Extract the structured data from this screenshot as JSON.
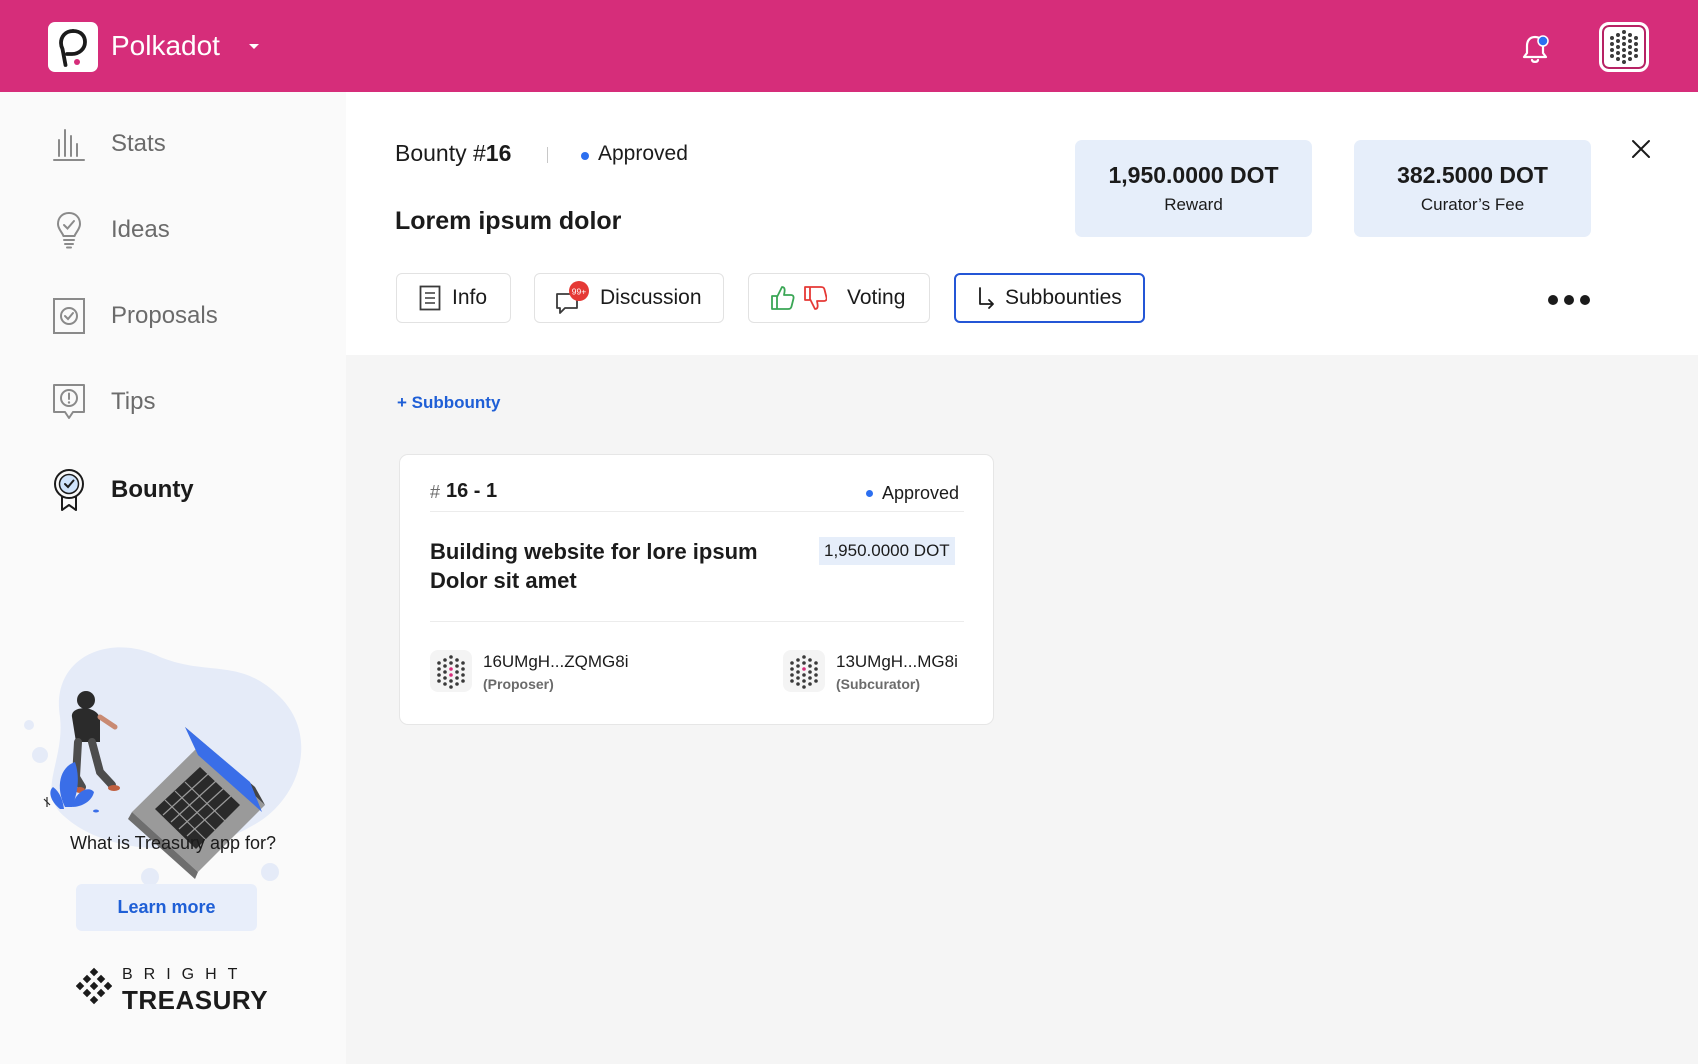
{
  "header": {
    "network_name": "Polkadot",
    "logo_icon": "polkadot-logo",
    "notification_icon": "bell-icon",
    "avatar_icon": "identicon-avatar",
    "brand_color": "#d62d7a"
  },
  "sidebar": {
    "items": [
      {
        "label": "Stats",
        "icon": "stats-icon",
        "active": false
      },
      {
        "label": "Ideas",
        "icon": "lightbulb-icon",
        "active": false
      },
      {
        "label": "Proposals",
        "icon": "proposal-check-icon",
        "active": false
      },
      {
        "label": "Tips",
        "icon": "tip-alert-icon",
        "active": false
      },
      {
        "label": "Bounty",
        "icon": "bounty-badge-icon",
        "active": true
      }
    ],
    "promo_text": "What is Treasury app for?",
    "learn_more_label": "Learn more",
    "brand_top": "BRIGHT",
    "brand_bottom": "TREASURY"
  },
  "bounty": {
    "label": "Bounty #",
    "number": "16",
    "status": "Approved",
    "title": "Lorem ipsum dolor",
    "reward_value": "1,950.0000 DOT",
    "reward_label": "Reward",
    "fee_value": "382.5000 DOT",
    "fee_label": "Curator’s Fee"
  },
  "tabs": [
    {
      "label": "Info",
      "icon": "document-icon"
    },
    {
      "label": "Discussion",
      "icon": "chat-bubble-icon",
      "badge": "99+"
    },
    {
      "label": "Voting",
      "icon": "thumbs-up-down-icon"
    },
    {
      "label": "Subbounties",
      "icon": "subdirectory-arrow-icon",
      "active": true
    }
  ],
  "content": {
    "add_subbounty_label": "+ Subbounty",
    "subbounty": {
      "hash": "#",
      "number": "16 - 1",
      "status": "Approved",
      "title": "Building website for lore ipsum Dolor sit amet",
      "amount": "1,950.0000 DOT",
      "proposer_address": "16UMgH...ZQMG8i",
      "proposer_role": "(Proposer)",
      "subcurator_address": "13UMgH...MG8i",
      "subcurator_role": "(Subcurator)"
    }
  },
  "colors": {
    "accent_blue": "#2456d6",
    "status_dot": "#2c6ff0",
    "badge_red": "#e53935",
    "thumb_up_green": "#3aa655",
    "thumb_down_red": "#e53935"
  }
}
